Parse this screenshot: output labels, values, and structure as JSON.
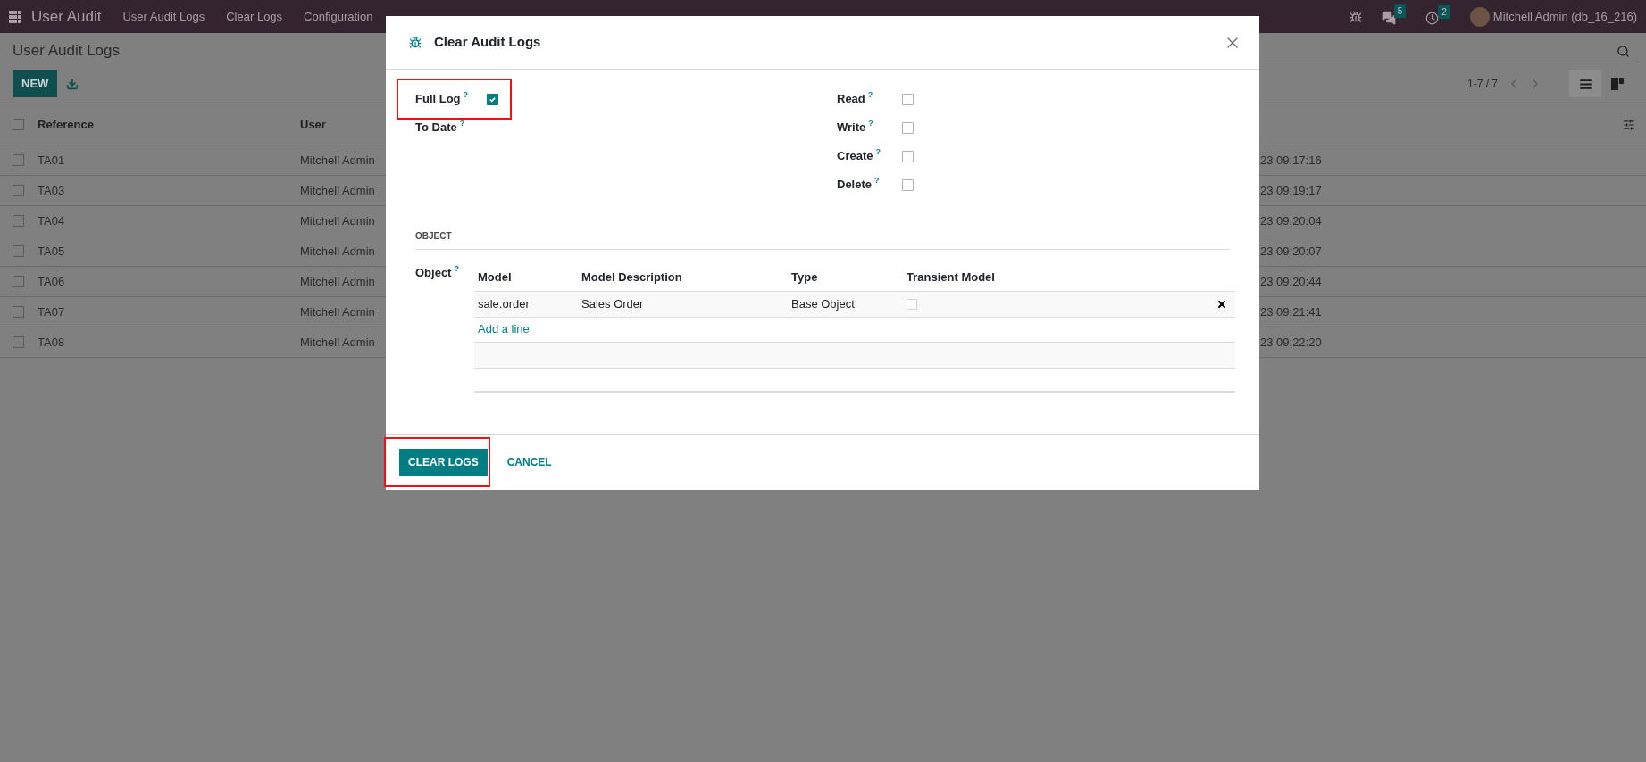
{
  "navbar": {
    "app_name": "User Audit",
    "menu": [
      "User Audit Logs",
      "Clear Logs",
      "Configuration"
    ],
    "messages_badge": "5",
    "activities_badge": "2",
    "user": "Mitchell Admin (db_16_216)"
  },
  "page": {
    "title": "User Audit Logs",
    "new_button": "NEW",
    "pager": "1-7 / 7",
    "views": [
      {
        "kind": "list",
        "selected": true
      },
      {
        "kind": "kanban",
        "selected": false
      }
    ]
  },
  "table": {
    "select_all_checked": false,
    "columns": [
      "Reference",
      "User"
    ],
    "rows": [
      {
        "checked": false,
        "reference": "TA01",
        "user": "Mitchell Admin",
        "column_3": "23 09:17:16"
      },
      {
        "checked": false,
        "reference": "TA03",
        "user": "Mitchell Admin",
        "column_3": "23 09:19:17"
      },
      {
        "checked": false,
        "reference": "TA04",
        "user": "Mitchell Admin",
        "column_3": "23 09:20:04"
      },
      {
        "checked": false,
        "reference": "TA05",
        "user": "Mitchell Admin",
        "column_3": "23 09:20:07"
      },
      {
        "checked": false,
        "reference": "TA06",
        "user": "Mitchell Admin",
        "column_3": "23 09:20:44"
      },
      {
        "checked": false,
        "reference": "TA07",
        "user": "Mitchell Admin",
        "column_3": "23 09:21:41"
      },
      {
        "checked": false,
        "reference": "TA08",
        "user": "Mitchell Admin",
        "column_3": "23 09:22:20"
      }
    ]
  },
  "dialog": {
    "title": "Clear Audit Logs",
    "left_fields": [
      {
        "label": "Full Log",
        "hint": "?",
        "kind": "checkbox",
        "checked": true,
        "highlighted": true
      },
      {
        "label": "To Date",
        "hint": "?",
        "kind": "date",
        "highlighted": false
      }
    ],
    "right_fields": [
      {
        "label": "Read",
        "hint": "?",
        "checked": false
      },
      {
        "label": "Write",
        "hint": "?",
        "checked": false
      },
      {
        "label": "Create",
        "hint": "?",
        "checked": false
      },
      {
        "label": "Delete",
        "hint": "?",
        "checked": false
      }
    ],
    "section": "OBJECT",
    "object_label": "Object",
    "object_hint": "?",
    "object_table": {
      "columns": [
        "Model",
        "Model Description",
        "Type",
        "Transient Model"
      ],
      "rows": [
        {
          "model": "sale.order",
          "description": "Sales Order",
          "type": "Base Object",
          "transient": false
        }
      ],
      "add_line": "Add a line"
    },
    "buttons": [
      {
        "label": "CLEAR LOGS",
        "kind": "primary",
        "highlighted": true
      },
      {
        "label": "CANCEL",
        "kind": "secondary",
        "highlighted": false
      }
    ]
  }
}
